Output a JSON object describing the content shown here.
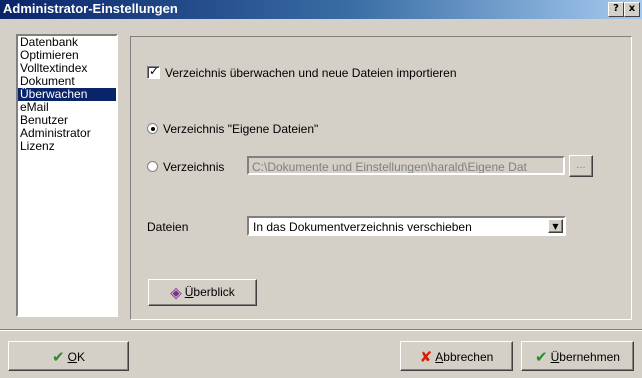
{
  "window": {
    "title": "Administrator-Einstellungen",
    "help_label": "?",
    "close_label": "x"
  },
  "sidebar": {
    "items": [
      {
        "label": "Datenbank",
        "selected": false
      },
      {
        "label": "Optimieren",
        "selected": false
      },
      {
        "label": "Volltextindex",
        "selected": false
      },
      {
        "label": "Dokument",
        "selected": false
      },
      {
        "label": "Überwachen",
        "selected": true
      },
      {
        "label": "eMail",
        "selected": false
      },
      {
        "label": "Benutzer",
        "selected": false
      },
      {
        "label": "Administrator",
        "selected": false
      },
      {
        "label": "Lizenz",
        "selected": false
      }
    ]
  },
  "panel": {
    "watch_checkbox": {
      "label": "Verzeichnis überwachen und neue Dateien importieren",
      "checked": true
    },
    "radio_own": {
      "label": "Verzeichnis \"Eigene Dateien\"",
      "selected": true
    },
    "radio_custom": {
      "label": "Verzeichnis",
      "selected": false
    },
    "path_value": "C:\\Dokumente und Einstellungen\\harald\\Eigene Dat",
    "browse_label": "...",
    "files_label": "Dateien",
    "files_select_value": "In das Dokumentverzeichnis verschieben",
    "overview_button": {
      "label_first": "Ü",
      "label_rest": "berblick",
      "icon": "book-icon"
    }
  },
  "footer": {
    "ok": {
      "label_first": "O",
      "label_rest": "K",
      "icon": "checkmark-icon"
    },
    "cancel": {
      "label_first": "A",
      "label_rest": "bbrechen",
      "icon": "cross-icon"
    },
    "apply": {
      "label_first": "Ü",
      "label_rest": "bernehmen",
      "icon": "checkmark-icon"
    }
  },
  "colors": {
    "titlebar": "#0a246a",
    "selection": "#0a246a",
    "ok_green": "#2e8b2e",
    "cancel_red": "#d81e05",
    "book_purple": "#7a2f8f"
  }
}
